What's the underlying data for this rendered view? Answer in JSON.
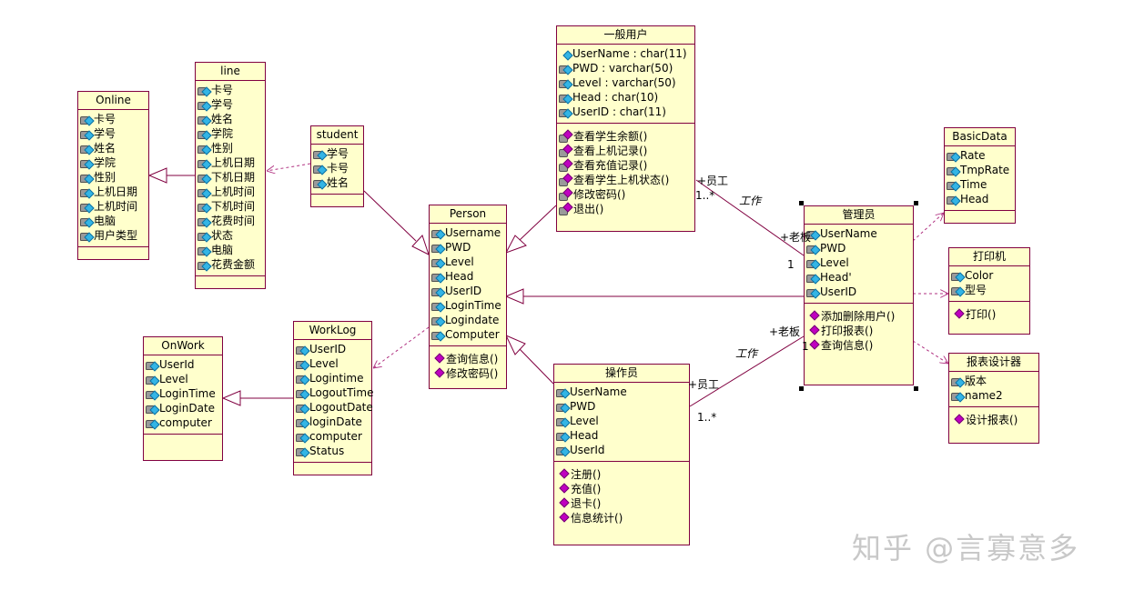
{
  "classes": {
    "online": {
      "name": "Online",
      "attributes": [
        "卡号",
        "学号",
        "姓名",
        "学院",
        "性别",
        "上机日期",
        "上机时间",
        "电脑",
        "用户类型"
      ],
      "operations": []
    },
    "line": {
      "name": "line",
      "attributes": [
        "卡号",
        "学号",
        "姓名",
        "学院",
        "性别",
        "上机日期",
        "下机日期",
        "上机时间",
        "下机时间",
        "花费时间",
        "状态",
        "电脑",
        "花费金额"
      ],
      "operations": []
    },
    "student": {
      "name": "student",
      "attributes": [
        "学号",
        "卡号",
        "姓名"
      ],
      "operations": []
    },
    "person": {
      "name": "Person",
      "attributes": [
        "Username",
        "PWD",
        "Level",
        "Head",
        "UserID",
        "LoginTime",
        "Logindate",
        "Computer"
      ],
      "operations": [
        "查询信息()",
        "修改密码()"
      ]
    },
    "general_user": {
      "name": "一般用户",
      "attributes": [
        "UserName : char(11)",
        "PWD : varchar(50)",
        "Level : varchar(50)",
        "Head : char(10)",
        "UserID : char(11)"
      ],
      "operations": [
        "查看学生余额()",
        "查看上机记录()",
        "查看充值记录()",
        "查看学生上机状态()",
        "修改密码()",
        "退出()"
      ]
    },
    "admin": {
      "name": "管理员",
      "attributes": [
        "UserName",
        "PWD",
        "Level",
        "Head'",
        "UserID"
      ],
      "operations": [
        "添加删除用户()",
        "打印报表()",
        "查询信息()"
      ]
    },
    "operator": {
      "name": "操作员",
      "attributes": [
        "UserName",
        "PWD",
        "Level",
        "Head",
        "UserId"
      ],
      "operations": [
        "注册()",
        "充值()",
        "退卡()",
        "信息统计()"
      ]
    },
    "onwork": {
      "name": "OnWork",
      "attributes": [
        "UserId",
        "Level",
        "LoginTime",
        "LoginDate",
        "computer"
      ],
      "operations": []
    },
    "worklog": {
      "name": "WorkLog",
      "attributes": [
        "UserID",
        "Level",
        "Logintime",
        "LogoutTime",
        "LogoutDate",
        "loginDate",
        "computer",
        "Status"
      ],
      "operations": []
    },
    "basicdata": {
      "name": "BasicData",
      "attributes": [
        "Rate",
        "TmpRate",
        "Time",
        "Head"
      ],
      "operations": []
    },
    "printer": {
      "name": "打印机",
      "attributes": [
        "Color",
        "型号"
      ],
      "operations": [
        "打印()"
      ]
    },
    "report_designer": {
      "name": "报表设计器",
      "attributes": [
        "版本",
        "name2"
      ],
      "operations": [
        "设计报表()"
      ]
    }
  },
  "associations": {
    "general_user_admin": {
      "role_a": "+员工",
      "mult_a": "1..*",
      "name": "工作",
      "role_b": "+老板",
      "mult_b": "1"
    },
    "operator_admin": {
      "role_a": "+员工",
      "mult_a": "1..*",
      "name": "工作",
      "role_b": "+老板",
      "mult_b": "1"
    }
  },
  "watermark": "知乎 @言寡意多",
  "colors": {
    "class_fill": "#ffffcc",
    "class_border": "#800040",
    "relation_line": "#800040"
  }
}
